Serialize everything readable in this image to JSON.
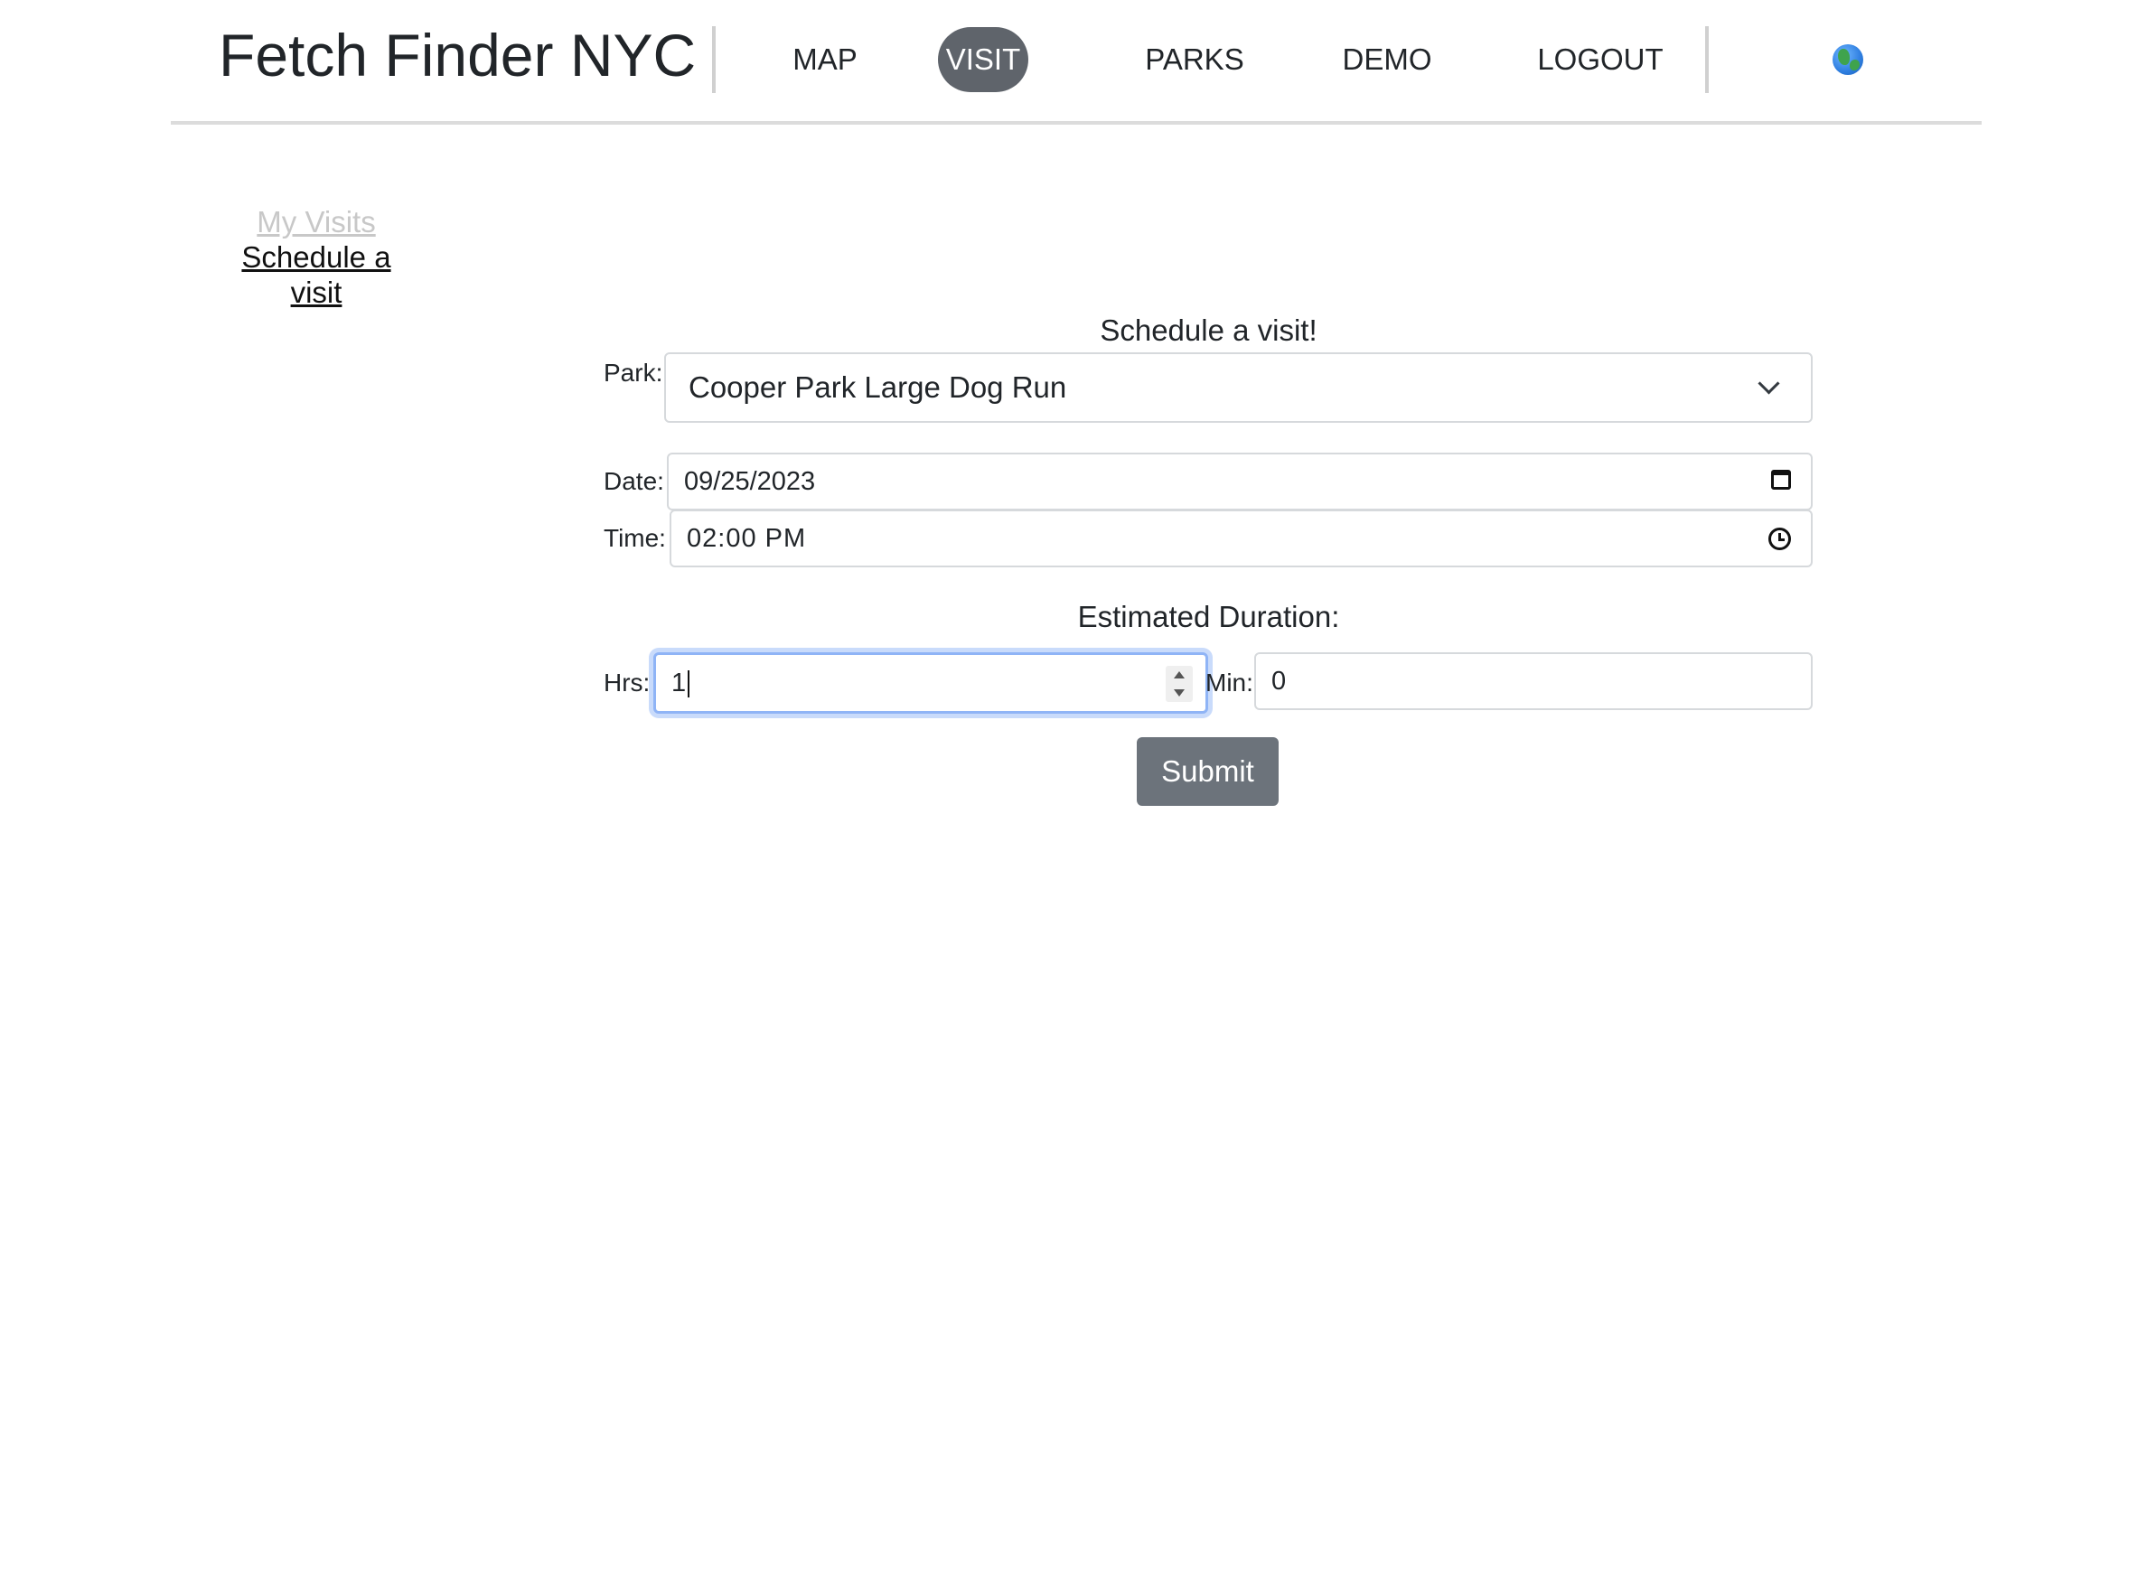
{
  "header": {
    "brand": "Fetch Finder NYC",
    "nav": {
      "map": "MAP",
      "visit": "VISIT",
      "parks": "PARKS",
      "demo": "DEMO",
      "logout": "LOGOUT"
    },
    "active_nav": "VISIT",
    "globe_icon": "globe-icon"
  },
  "sidebar": {
    "my_visits": "My Visits",
    "schedule_line1": "Schedule a",
    "schedule_line2": "visit"
  },
  "form": {
    "title": "Schedule a visit!",
    "park_label": "Park:",
    "park_value": "Cooper Park Large Dog Run",
    "date_label": "Date:",
    "date_value": "09/25/2023",
    "time_label": "Time:",
    "time_value": "02:00 PM",
    "duration_title": "Estimated Duration:",
    "hrs_label": "Hrs:",
    "hrs_value": "1",
    "min_label": "Min:",
    "min_value": "0",
    "submit_label": "Submit"
  },
  "colors": {
    "active_nav_bg": "#5f646b",
    "submit_bg": "#6c737b",
    "focus_ring": "#8fb4f6"
  }
}
